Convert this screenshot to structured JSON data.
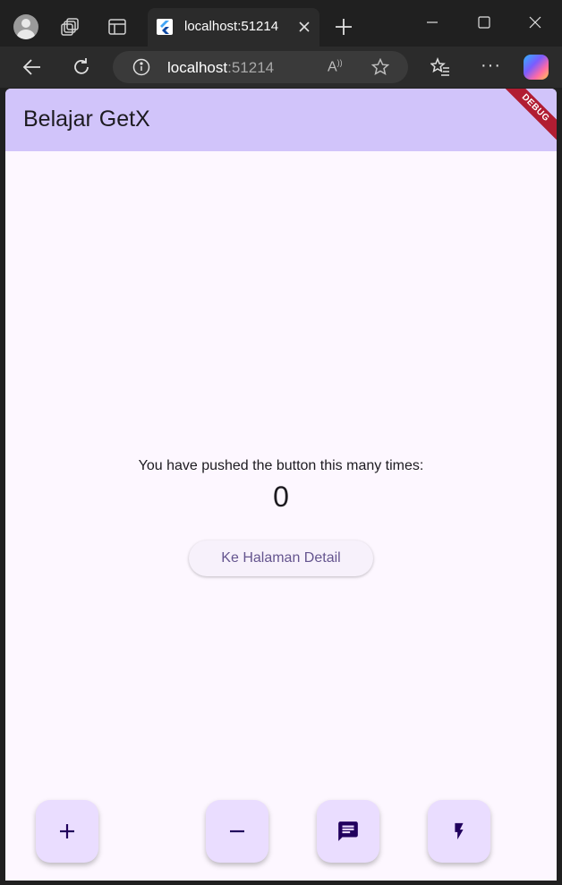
{
  "browser": {
    "tab_title": "localhost:51214",
    "url_host": "localhost",
    "url_port": ":51214"
  },
  "app": {
    "title": "Belajar GetX",
    "debug_banner": "DEBUG",
    "message": "You have pushed the button this many times:",
    "counter": "0",
    "detail_button_label": "Ke Halaman Detail",
    "fabs": [
      {
        "icon": "plus-icon"
      },
      {
        "icon": "minus-icon"
      },
      {
        "icon": "message-icon"
      },
      {
        "icon": "flash-icon"
      }
    ]
  },
  "colors": {
    "appbar": "#d1c4fa",
    "background": "#fdf7ff",
    "fab": "#eaddff",
    "fab_icon": "#21005d",
    "button_text": "#65558f",
    "debug_banner": "#b11d32"
  }
}
